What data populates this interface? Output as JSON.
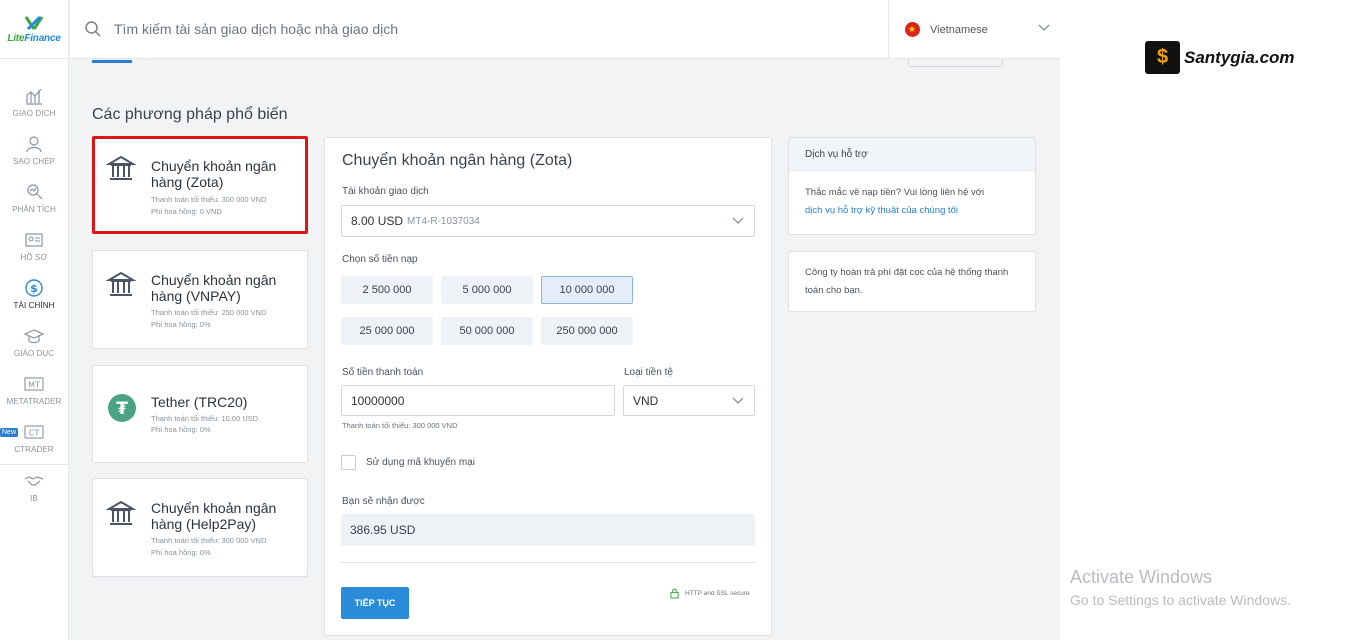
{
  "logo": {
    "text_left": "Lite",
    "text_right": "Finance"
  },
  "search": {
    "placeholder": "Tìm kiếm tài sản giao dịch hoặc nhà giao dịch"
  },
  "language": {
    "label": "Vietnamese"
  },
  "watermark": {
    "text": "Santygia.com",
    "glyph": "$"
  },
  "activate": {
    "title": "Activate Windows",
    "subtitle": "Go to Settings to activate Windows."
  },
  "sidebar": {
    "items": [
      {
        "label": "GIAO DỊCH",
        "icon": "chart-icon"
      },
      {
        "label": "SAO CHÉP",
        "icon": "copy-user-icon"
      },
      {
        "label": "PHÂN TÍCH",
        "icon": "analysis-icon"
      },
      {
        "label": "HỒ SƠ",
        "icon": "profile-card-icon"
      },
      {
        "label": "TÀI CHÍNH",
        "icon": "dollar-icon"
      },
      {
        "label": "GIÁO DỤC",
        "icon": "graduation-cap-icon"
      },
      {
        "label": "METATRADER",
        "icon": "mt-icon",
        "glyph": "MT"
      },
      {
        "label": "CTRADER",
        "icon": "ct-icon",
        "glyph": "CT",
        "badge": "New"
      },
      {
        "label": "IB",
        "icon": "handshake-icon"
      }
    ]
  },
  "main": {
    "section_title": "Các phương pháp phổ biến",
    "methods": [
      {
        "name": "Chuyển khoản ngân hàng (Zota)",
        "min": "Thanh toán tối thiểu: 300 000 VND",
        "fee": "Phí hoa hồng: 0 VND",
        "icon": "bank-icon"
      },
      {
        "name": "Chuyển khoản ngân hàng (VNPAY)",
        "min": "Thanh toán tối thiểu: 250 000 VND",
        "fee": "Phí hoa hồng: 0%",
        "icon": "bank-icon"
      },
      {
        "name": "Tether (TRC20)",
        "min": "Thanh toán tối thiểu: 10.00 USD",
        "fee": "Phí hoa hồng: 0%",
        "icon": "tether-icon",
        "glyph": "₮"
      },
      {
        "name": "Chuyển khoản ngân hàng (Help2Pay)",
        "min": "Thanh toán tối thiểu: 300 000 VND",
        "fee": "Phí hoa hồng: 0%",
        "icon": "bank-icon"
      }
    ]
  },
  "form": {
    "title": "Chuyển khoản ngân hàng (Zota)",
    "account_label": "Tài khoản giao dịch",
    "account_value": "8.00 USD",
    "account_id": "MT4-R-1037034",
    "amount_label": "Chọn số tiền nạp",
    "amounts": [
      "2 500 000",
      "5 000 000",
      "10 000 000",
      "25 000 000",
      "50 000 000",
      "250 000 000"
    ],
    "selected_amount": "10 000 000",
    "payment_label": "Số tiền thanh toán",
    "payment_value": "10000000",
    "currency_label": "Loại tiền tệ",
    "currency_value": "VND",
    "min_note": "Thanh toán tối thiểu: 300 000 VND",
    "promo_label": "Sử dụng mã khuyến mại",
    "receive_label": "Bạn sẽ nhận được",
    "receive_value": "386.95 USD",
    "continue_label": "TIẾP TỤC",
    "secure_label": "HTTP and SSL secure"
  },
  "support": {
    "title": "Dịch vụ hỗ trợ",
    "text": "Thắc mắc về nạp tiền? Vui lòng liên hệ với",
    "link": "dịch vụ hỗ trợ kỹ thuật của chúng tôi",
    "refund_text": "Công ty hoàn trả phí đặt cọc của hệ thống thanh toán cho bạn."
  },
  "colors": {
    "accent": "#2a8bd8",
    "selected_border": "#e01414",
    "tether": "#4aa383",
    "logo_green": "#3ba53b"
  }
}
